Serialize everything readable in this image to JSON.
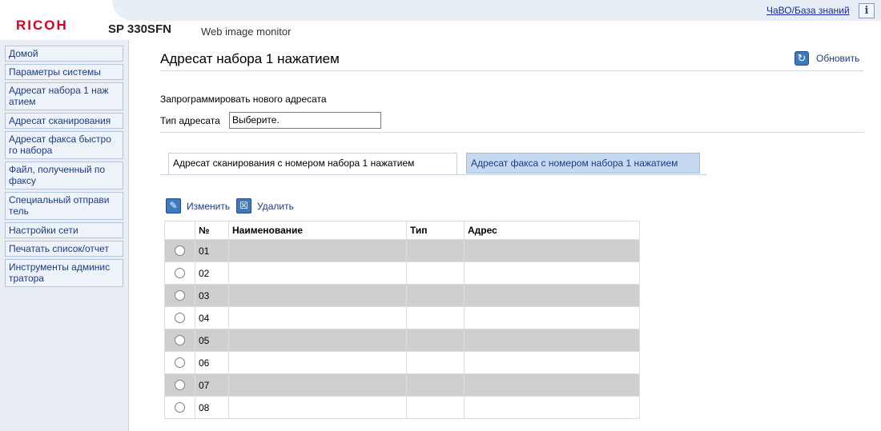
{
  "header": {
    "logo": "RICOH",
    "model": "SP 330SFN",
    "subtitle": "Web image monitor",
    "faq_link": "ЧаВО/База знаний",
    "info_icon": "i"
  },
  "sidebar": {
    "items": [
      "Домой",
      "Параметры системы",
      "Адресат набора 1 наж\nатием",
      "Адресат сканирования",
      "Адресат факса быстро\nго набора",
      "Файл, полученный по\nфаксу",
      "Специальный отправи\nтель",
      "Настройки сети",
      "Печатать список/отчет",
      "Инструменты админис\nтратора"
    ]
  },
  "main": {
    "title": "Адресат набора 1 нажатием",
    "refresh_label": "Обновить",
    "program_label": "Запрограммировать нового адресата",
    "type_label": "Тип адресата",
    "type_select_value": "Выберите."
  },
  "tabs": {
    "scan": "Адресат сканирования с номером набора 1 нажатием",
    "fax": "Адресат факса с номером набора 1 нажатием"
  },
  "toolbar": {
    "edit_label": "Изменить",
    "delete_label": "Удалить"
  },
  "table": {
    "headers": [
      "",
      "№",
      "Наименование",
      "Тип",
      "Адрес"
    ],
    "rows": [
      {
        "num": "01",
        "name": "",
        "type": "",
        "address": ""
      },
      {
        "num": "02",
        "name": "",
        "type": "",
        "address": ""
      },
      {
        "num": "03",
        "name": "",
        "type": "",
        "address": ""
      },
      {
        "num": "04",
        "name": "",
        "type": "",
        "address": ""
      },
      {
        "num": "05",
        "name": "",
        "type": "",
        "address": ""
      },
      {
        "num": "06",
        "name": "",
        "type": "",
        "address": ""
      },
      {
        "num": "07",
        "name": "",
        "type": "",
        "address": ""
      },
      {
        "num": "08",
        "name": "",
        "type": "",
        "address": ""
      }
    ]
  },
  "colors": {
    "brand_red": "#d9001a",
    "link_blue": "#1d3b83",
    "header_band": "#e7eef6",
    "sidebar_bg": "#e9eef4",
    "active_tab_bg": "#c5d9f1",
    "row_gray": "#cfcfcf"
  },
  "icons": {
    "refresh": "refresh-icon",
    "edit": "edit-icon",
    "delete": "trash-icon",
    "info": "info-icon"
  }
}
